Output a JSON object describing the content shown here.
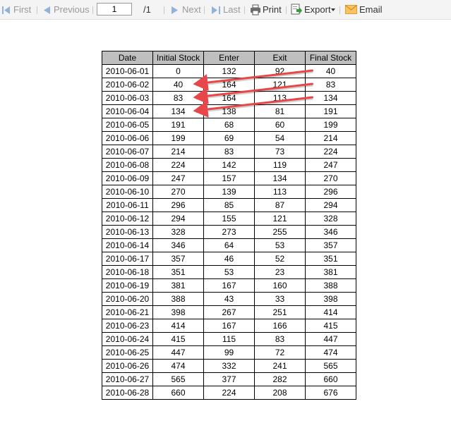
{
  "toolbar": {
    "first_label": "First",
    "previous_label": "Previous",
    "page_value": "1",
    "page_total": "/1",
    "next_label": "Next",
    "last_label": "Last",
    "print_label": "Print",
    "export_label": "Export",
    "email_label": "Email",
    "icons": [
      "first-icon",
      "previous-icon",
      "next-icon",
      "last-icon",
      "printer-icon",
      "export-icon",
      "dropdown-caret-icon",
      "envelope-icon"
    ]
  },
  "table": {
    "headers": [
      "Date",
      "Initial Stock",
      "Enter",
      "Exit",
      "Final Stock"
    ],
    "rows": [
      [
        "2010-06-01",
        "0",
        "132",
        "92",
        "40"
      ],
      [
        "2010-06-02",
        "40",
        "164",
        "121",
        "83"
      ],
      [
        "2010-06-03",
        "83",
        "164",
        "113",
        "134"
      ],
      [
        "2010-06-04",
        "134",
        "138",
        "81",
        "191"
      ],
      [
        "2010-06-05",
        "191",
        "68",
        "60",
        "199"
      ],
      [
        "2010-06-06",
        "199",
        "69",
        "54",
        "214"
      ],
      [
        "2010-06-07",
        "214",
        "83",
        "73",
        "224"
      ],
      [
        "2010-06-08",
        "224",
        "142",
        "119",
        "247"
      ],
      [
        "2010-06-09",
        "247",
        "157",
        "134",
        "270"
      ],
      [
        "2010-06-10",
        "270",
        "139",
        "113",
        "296"
      ],
      [
        "2010-06-11",
        "296",
        "85",
        "87",
        "294"
      ],
      [
        "2010-06-12",
        "294",
        "155",
        "121",
        "328"
      ],
      [
        "2010-06-13",
        "328",
        "273",
        "255",
        "346"
      ],
      [
        "2010-06-14",
        "346",
        "64",
        "53",
        "357"
      ],
      [
        "2010-06-17",
        "357",
        "46",
        "52",
        "351"
      ],
      [
        "2010-06-18",
        "351",
        "53",
        "23",
        "381"
      ],
      [
        "2010-06-19",
        "381",
        "167",
        "160",
        "388"
      ],
      [
        "2010-06-20",
        "388",
        "43",
        "33",
        "398"
      ],
      [
        "2010-06-21",
        "398",
        "267",
        "251",
        "414"
      ],
      [
        "2010-06-23",
        "414",
        "167",
        "166",
        "415"
      ],
      [
        "2010-06-24",
        "415",
        "115",
        "83",
        "447"
      ],
      [
        "2010-06-25",
        "447",
        "99",
        "72",
        "474"
      ],
      [
        "2010-06-26",
        "474",
        "332",
        "241",
        "565"
      ],
      [
        "2010-06-27",
        "565",
        "377",
        "282",
        "660"
      ],
      [
        "2010-06-28",
        "660",
        "224",
        "208",
        "676"
      ]
    ]
  },
  "annotations": {
    "arrow_color": "#e8474a",
    "arrows": [
      {
        "from_row": 0,
        "from_column": "Final Stock",
        "to_row": 1,
        "to_column": "Initial Stock"
      },
      {
        "from_row": 1,
        "from_column": "Final Stock",
        "to_row": 2,
        "to_column": "Initial Stock"
      },
      {
        "from_row": 2,
        "from_column": "Final Stock",
        "to_row": 3,
        "to_column": "Initial Stock"
      }
    ]
  },
  "colors": {
    "toolbar_bg": "#f4f4f4",
    "disabled_text": "#999999",
    "enabled_text": "#333333",
    "header_bg": "#bfbfbf",
    "nav_icon": "#8fb3d9",
    "export_icon": "#3a9a3a",
    "email_icon": "#f0a030"
  }
}
